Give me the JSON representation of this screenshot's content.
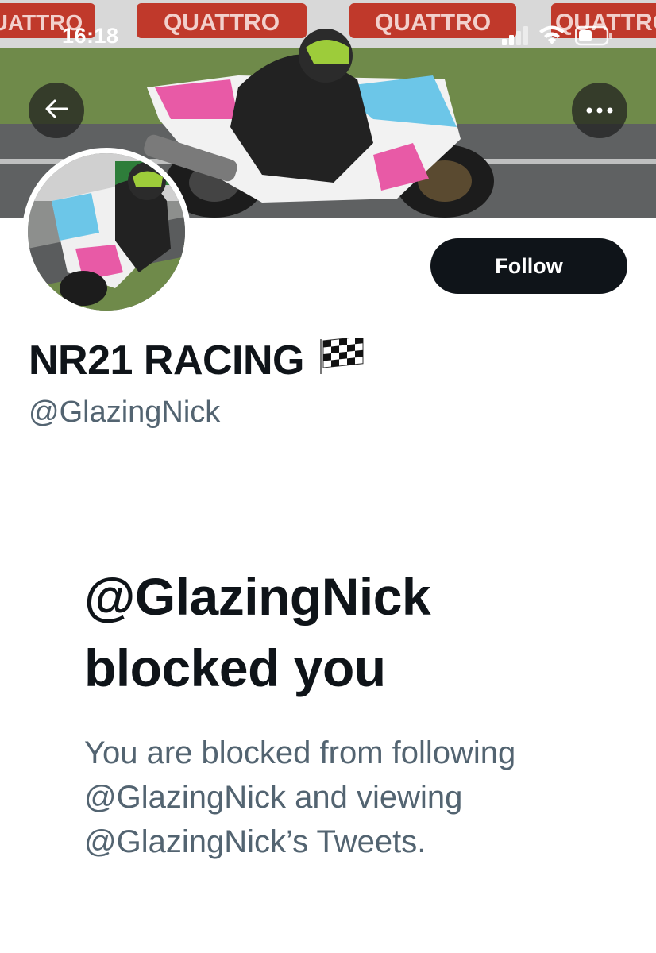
{
  "status_bar": {
    "time": "16:18",
    "icons": [
      "cellular-signal-icon",
      "wifi-icon",
      "battery-icon"
    ]
  },
  "header": {
    "banner_sign_text": "QUATTRO",
    "back_icon": "back-arrow-icon",
    "more_icon": "more-horizontal-icon"
  },
  "profile": {
    "display_name": "NR21 RACING",
    "name_emoji": "🏁",
    "handle": "@GlazingNick",
    "follow_label": "Follow"
  },
  "blocked": {
    "title": "@GlazingNick blocked you",
    "description": "You are blocked from following @GlazingNick and viewing @GlazingNick’s Tweets."
  },
  "colors": {
    "text_primary": "#0f1419",
    "text_secondary": "#536471",
    "follow_button_bg": "#0f1419",
    "background": "#ffffff"
  }
}
